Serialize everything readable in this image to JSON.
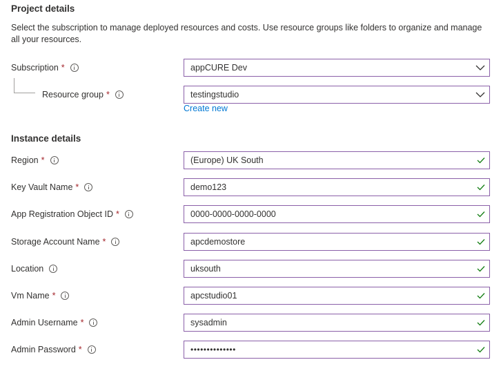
{
  "project": {
    "title": "Project details",
    "description": "Select the subscription to manage deployed resources and costs. Use resource groups like folders to organize and manage all your resources.",
    "subscription": {
      "label": "Subscription",
      "required": "*",
      "value": "appCURE Dev"
    },
    "resource_group": {
      "label": "Resource group",
      "required": "*",
      "value": "testingstudio",
      "create_new": "Create new"
    }
  },
  "instance": {
    "title": "Instance details",
    "fields": [
      {
        "label": "Region",
        "required": "*",
        "value": "(Europe) UK South"
      },
      {
        "label": "Key Vault Name",
        "required": "*",
        "value": "demo123"
      },
      {
        "label": "App Registration Object ID",
        "required": "*",
        "value": "0000-0000-0000-0000"
      },
      {
        "label": "Storage Account Name",
        "required": "*",
        "value": "apcdemostore"
      },
      {
        "label": "Location",
        "required": "",
        "value": "uksouth"
      },
      {
        "label": "Vm Name",
        "required": "*",
        "value": "apcstudio01"
      },
      {
        "label": "Admin Username",
        "required": "*",
        "value": "sysadmin"
      },
      {
        "label": "Admin Password",
        "required": "*",
        "value": "••••••••••••••"
      }
    ]
  },
  "icons": {
    "info": "info-icon",
    "dropdown": "chevron-down-icon",
    "valid": "checkmark-icon"
  },
  "colors": {
    "field_border": "#8a5fa8",
    "valid_check": "#107c10",
    "required_star": "#a4262c",
    "link": "#0078d4"
  }
}
